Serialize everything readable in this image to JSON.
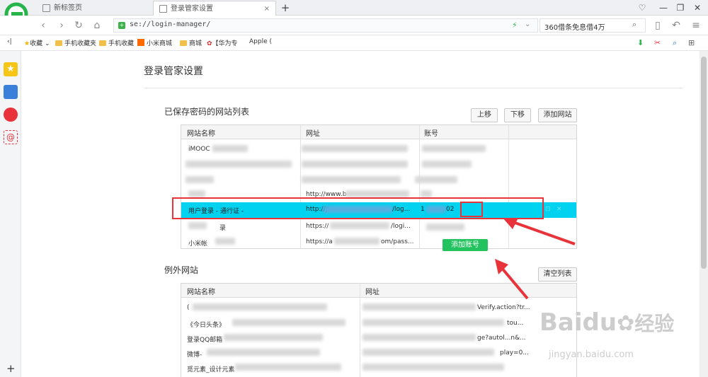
{
  "tabs": [
    {
      "label": "新标签页",
      "close": "×"
    },
    {
      "label": "登录管家设置",
      "close": "×"
    }
  ],
  "new_tab": "+",
  "window_buttons": [
    "♡",
    "—",
    "❐",
    "✕"
  ],
  "address": {
    "url": "se://login-manager/",
    "search_text": "360借条免息借4万"
  },
  "bookmarks": [
    "收藏",
    "手机收藏夹",
    "手机收藏",
    "小米商城",
    "商城",
    "【华为专",
    "Apple ("
  ],
  "page": {
    "title": "登录管家设置"
  },
  "saved_section": {
    "title": "已保存密码的网站列表",
    "buttons": {
      "up": "上移",
      "down": "下移",
      "add_site": "添加网站"
    },
    "columns": [
      "网站名称",
      "网址",
      "账号"
    ],
    "rows": [
      {
        "name": "iMOOC",
        "url": "",
        "account": ""
      },
      {
        "name": "",
        "url": "",
        "account": ""
      },
      {
        "name": "",
        "url": "",
        "account": ""
      },
      {
        "name": "",
        "url": "http://www.b",
        "account": ""
      },
      {
        "name": "用户登录 - 通行证 -",
        "url": "http://p",
        "url_tail": "/log...",
        "account": "1",
        "account_tail": "02"
      },
      {
        "name": "录",
        "url": "https://",
        "url_tail": "/logi...",
        "account": ""
      },
      {
        "name": "小米帐",
        "url": "https://a",
        "url_tail": "om/pass...",
        "account": ""
      }
    ],
    "add_account": "添加账号"
  },
  "exception_section": {
    "title": "例外网站",
    "clear_button": "清空列表",
    "columns": [
      "网站名称",
      "网址"
    ],
    "rows": [
      {
        "name": "(",
        "url": "Verify.action?tr..."
      },
      {
        "name": "《今日头条》",
        "url": "tou..."
      },
      {
        "name": "登录QQ邮箱",
        "url": "ge?autol...n&..."
      },
      {
        "name": "微博-",
        "url": "play=0..."
      },
      {
        "name": "觅元素_设计元素",
        "url": ""
      }
    ]
  },
  "watermark": {
    "brand": "Baidu",
    "sub": "经验",
    "url": "jingyan.baidu.com"
  },
  "colors": {
    "selected_row": "#00d2f0",
    "highlight": "#e8333a",
    "add_account": "#22c35e",
    "logo": "#27b44a"
  }
}
